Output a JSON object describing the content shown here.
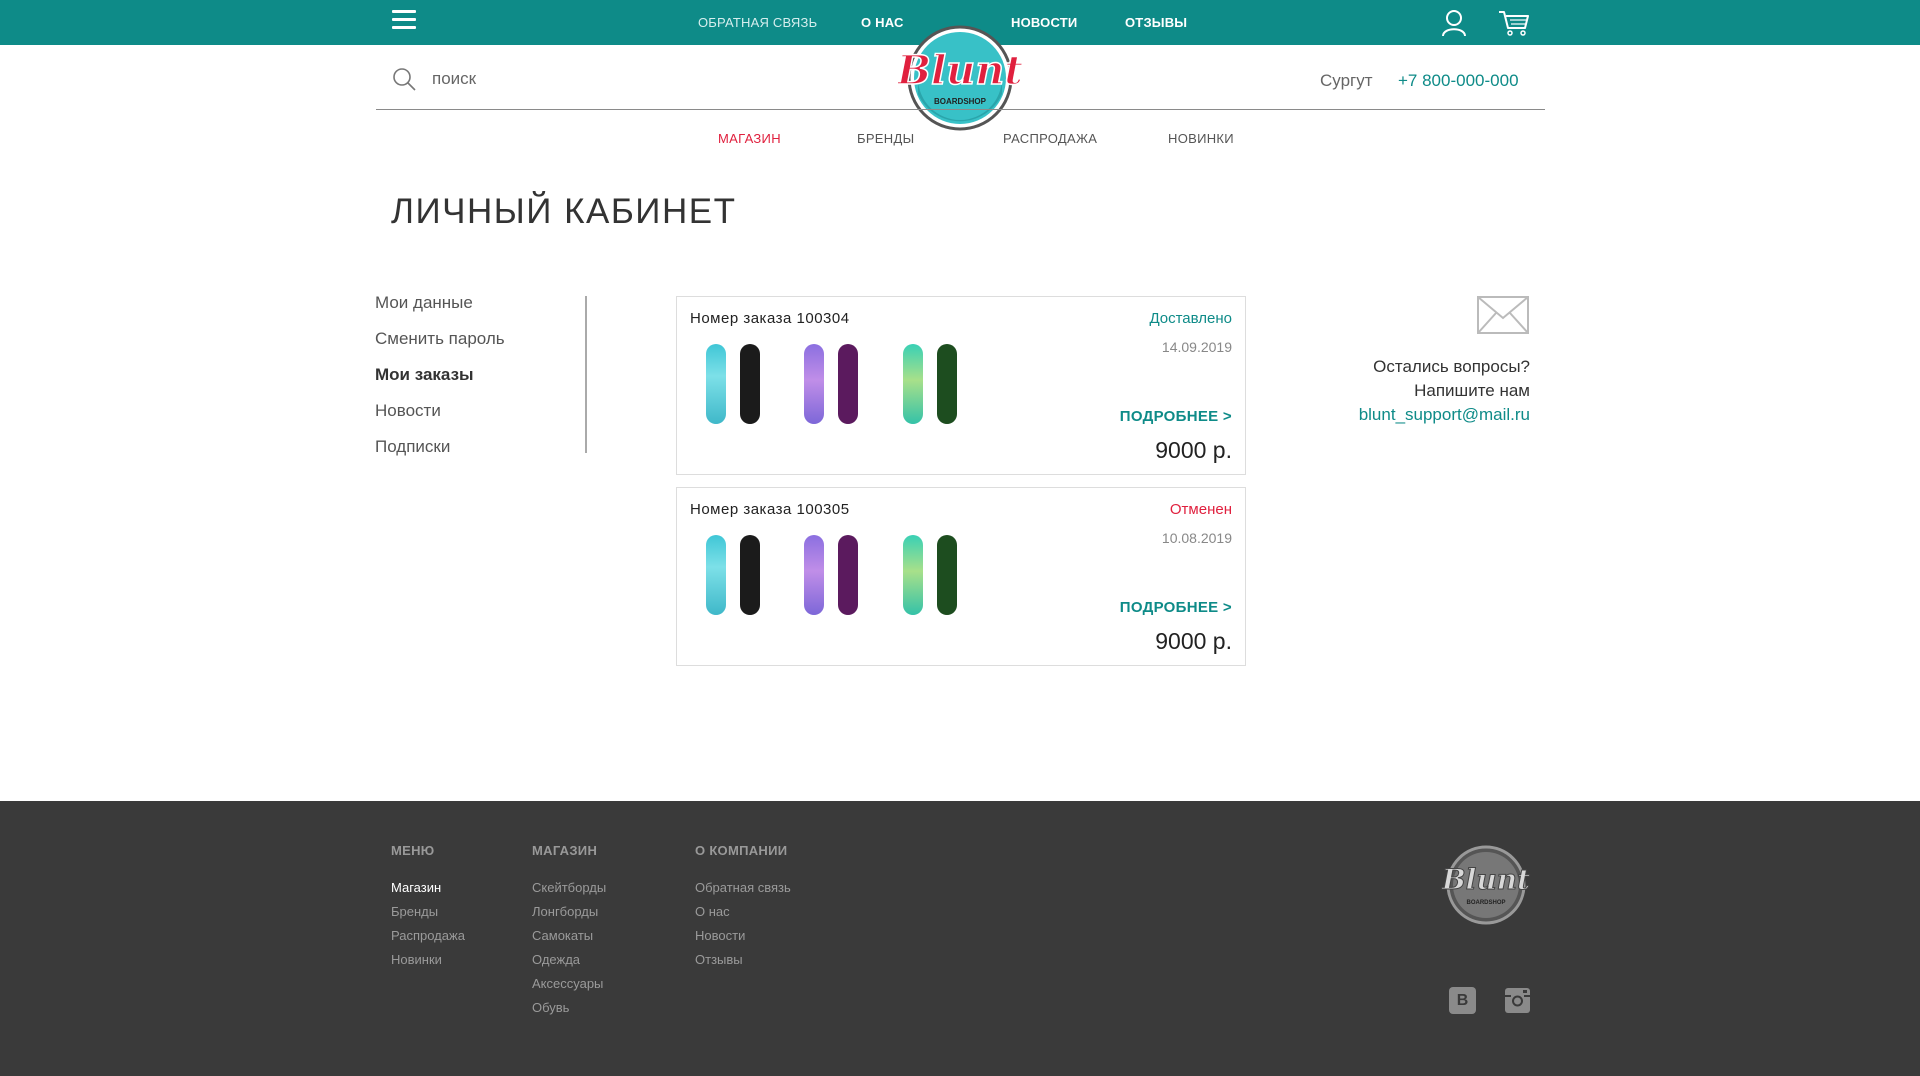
{
  "colors": {
    "brand": "#0e8b88",
    "accent": "#e0203e",
    "footer": "#3a3a3a"
  },
  "topbar": {
    "menu_icon": "burger-icon",
    "nav": [
      {
        "label": "ОБРАТНАЯ СВЯЗЬ"
      },
      {
        "label": "О НАС"
      },
      {
        "label": "НОВОСТИ"
      },
      {
        "label": "ОТЗЫВЫ"
      }
    ],
    "user_icon": "user-icon",
    "cart_icon": "cart-icon"
  },
  "logo": {
    "text": "Blunt",
    "sub": "BOARDSHOP"
  },
  "search": {
    "placeholder": "поиск",
    "value": ""
  },
  "header": {
    "city": "Сургут",
    "phone": "+7 800-000-000"
  },
  "catnav": [
    {
      "label": "МАГАЗИН",
      "active": true
    },
    {
      "label": "БРЕНДЫ"
    },
    {
      "label": "РАСПРОДАЖА"
    },
    {
      "label": "НОВИНКИ"
    }
  ],
  "page_title": "ЛИЧНЫЙ КАБИНЕТ",
  "sidebar": [
    {
      "label": "Мои данные"
    },
    {
      "label": "Сменить пароль"
    },
    {
      "label": "Мои заказы",
      "active": true
    },
    {
      "label": "Новости"
    },
    {
      "label": "Подписки"
    }
  ],
  "orders": [
    {
      "number": "Номер заказа 100304",
      "status": "Доставлено",
      "status_color": "#0e8b88",
      "date": "14.09.2019",
      "more": "ПОДРОБНЕЕ >",
      "price": "9000 р."
    },
    {
      "number": "Номер заказа 100305",
      "status": "Отменен",
      "status_color": "#e0203e",
      "date": "10.08.2019",
      "more": "ПОДРОБНЕЕ >",
      "price": "9000 р."
    }
  ],
  "help": {
    "line1": "Остались вопросы?",
    "line2": "Напишите нам",
    "email": "blunt_support@mail.ru"
  },
  "footer": {
    "columns": [
      {
        "title": "МЕНЮ",
        "items": [
          "Магазин",
          "Бренды",
          "Распродажа",
          "Новинки"
        ]
      },
      {
        "title": "МАГАЗИН",
        "items": [
          "Скейтборды",
          "Лонгборды",
          "Самокаты",
          "Одежда",
          "Аксессуары",
          "Обувь"
        ]
      },
      {
        "title": "О КОМПАНИИ",
        "items": [
          "Обратная связь",
          "О нас",
          "Новости",
          "Отзывы"
        ]
      }
    ],
    "logo_text": "Blunt",
    "logo_sub": "BOARDSHOP",
    "social": {
      "vk": "B"
    }
  }
}
